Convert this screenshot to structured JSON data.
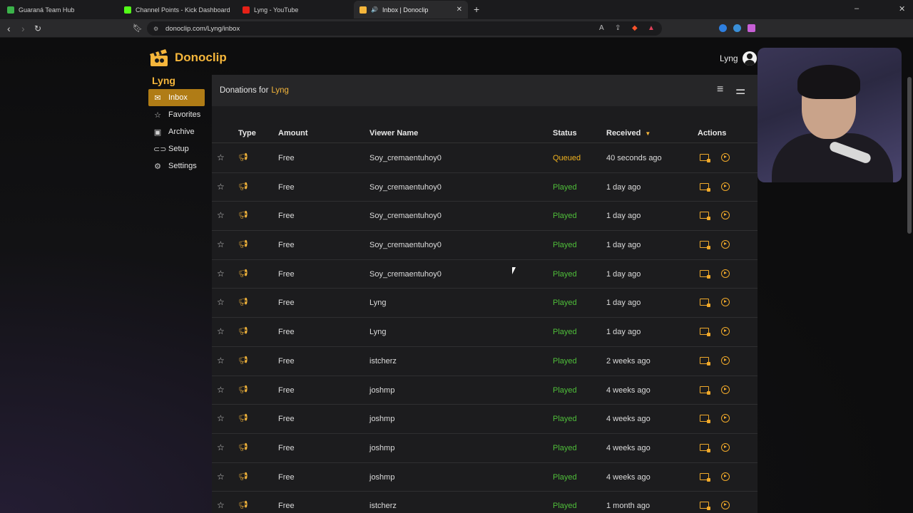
{
  "browser": {
    "tabs": [
      {
        "title": "Guaraná Team Hub",
        "favicon_color": "#3bb34a"
      },
      {
        "title": "Channel Points - Kick Dashboard",
        "favicon_color": "#53fc18"
      },
      {
        "title": "Lyng - YouTube",
        "favicon_color": "#e62117"
      },
      {
        "title": "Inbox | Donoclip",
        "favicon_color": "#f5b63b",
        "active": true
      }
    ],
    "url": "donoclip.com/Lyng/inbox"
  },
  "app": {
    "brand": "Donoclip",
    "accent": "#f5b63b",
    "user_name": "Lyng"
  },
  "sidebar": {
    "owner": "Lyng",
    "items": [
      {
        "label": "Inbox",
        "icon": "inbox-icon",
        "active": true
      },
      {
        "label": "Favorites",
        "icon": "star-icon"
      },
      {
        "label": "Archive",
        "icon": "archive-icon"
      },
      {
        "label": "Setup",
        "icon": "link-icon"
      },
      {
        "label": "Settings",
        "icon": "gear-icon"
      }
    ]
  },
  "panel": {
    "title_prefix": "Donations for",
    "title_owner": "Lyng"
  },
  "table": {
    "headers": {
      "type": "Type",
      "amount": "Amount",
      "viewer": "Viewer Name",
      "status": "Status",
      "received": "Received",
      "actions": "Actions"
    },
    "rows": [
      {
        "amount": "Free",
        "viewer": "Soy_cremaentuhoy0",
        "status": "Queued",
        "received": "40 seconds ago"
      },
      {
        "amount": "Free",
        "viewer": "Soy_cremaentuhoy0",
        "status": "Played",
        "received": "1 day ago"
      },
      {
        "amount": "Free",
        "viewer": "Soy_cremaentuhoy0",
        "status": "Played",
        "received": "1 day ago"
      },
      {
        "amount": "Free",
        "viewer": "Soy_cremaentuhoy0",
        "status": "Played",
        "received": "1 day ago"
      },
      {
        "amount": "Free",
        "viewer": "Soy_cremaentuhoy0",
        "status": "Played",
        "received": "1 day ago"
      },
      {
        "amount": "Free",
        "viewer": "Lyng",
        "status": "Played",
        "received": "1 day ago"
      },
      {
        "amount": "Free",
        "viewer": "Lyng",
        "status": "Played",
        "received": "1 day ago"
      },
      {
        "amount": "Free",
        "viewer": "istcherz",
        "status": "Played",
        "received": "2 weeks ago"
      },
      {
        "amount": "Free",
        "viewer": "joshmp",
        "status": "Played",
        "received": "4 weeks ago"
      },
      {
        "amount": "Free",
        "viewer": "joshmp",
        "status": "Played",
        "received": "4 weeks ago"
      },
      {
        "amount": "Free",
        "viewer": "joshmp",
        "status": "Played",
        "received": "4 weeks ago"
      },
      {
        "amount": "Free",
        "viewer": "joshmp",
        "status": "Played",
        "received": "4 weeks ago"
      },
      {
        "amount": "Free",
        "viewer": "istcherz",
        "status": "Played",
        "received": "1 month ago"
      }
    ]
  },
  "colors": {
    "queued": "#f0b21f",
    "played": "#4fbf3a"
  }
}
